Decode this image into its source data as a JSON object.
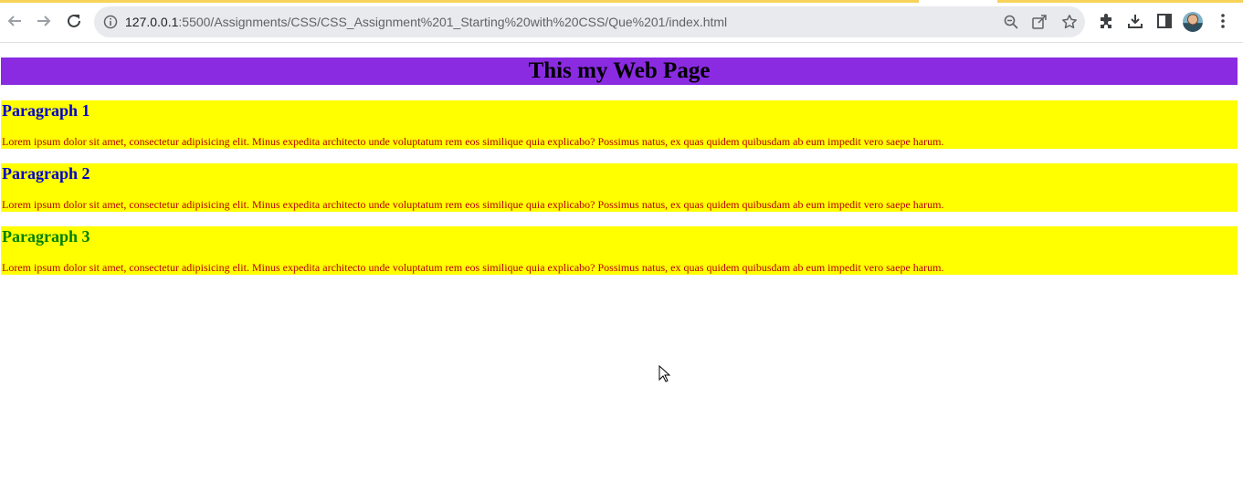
{
  "browser": {
    "url_host": "127.0.0.1",
    "url_rest": ":5500/Assignments/CSS/CSS_Assignment%201_Starting%20with%20CSS/Que%201/index.html",
    "icons": [
      "back-arrow-icon",
      "forward-arrow-icon",
      "reload-icon",
      "info-icon",
      "zoom-icon",
      "share-icon",
      "bookmark-star-icon",
      "extensions-icon",
      "download-icon",
      "side-panel-icon",
      "avatar",
      "more-menu-icon"
    ]
  },
  "page": {
    "title": "This my Web Page",
    "title_bg": "#8a2be2",
    "section_bg": "#ffff00",
    "paragraphs": [
      {
        "heading": "Paragraph 1",
        "heading_color": "#0000cc",
        "text": "Lorem ipsum dolor sit amet, consectetur adipisicing elit. Minus expedita architecto unde voluptatum rem eos similique quia explicabo? Possimus natus, ex quas quidem quibusdam ab eum impedit vero saepe harum."
      },
      {
        "heading": "Paragraph 2",
        "heading_color": "#0000cc",
        "text": "Lorem ipsum dolor sit amet, consectetur adipisicing elit. Minus expedita architecto unde voluptatum rem eos similique quia explicabo? Possimus natus, ex quas quidem quibusdam ab eum impedit vero saepe harum."
      },
      {
        "heading": "Paragraph 3",
        "heading_color": "#008000",
        "text": "Lorem ipsum dolor sit amet, consectetur adipisicing elit. Minus expedita architecto unde voluptatum rem eos similique quia explicabo? Possimus natus, ex quas quidem quibusdam ab eum impedit vero saepe harum."
      }
    ],
    "text_color": "#b80000"
  }
}
